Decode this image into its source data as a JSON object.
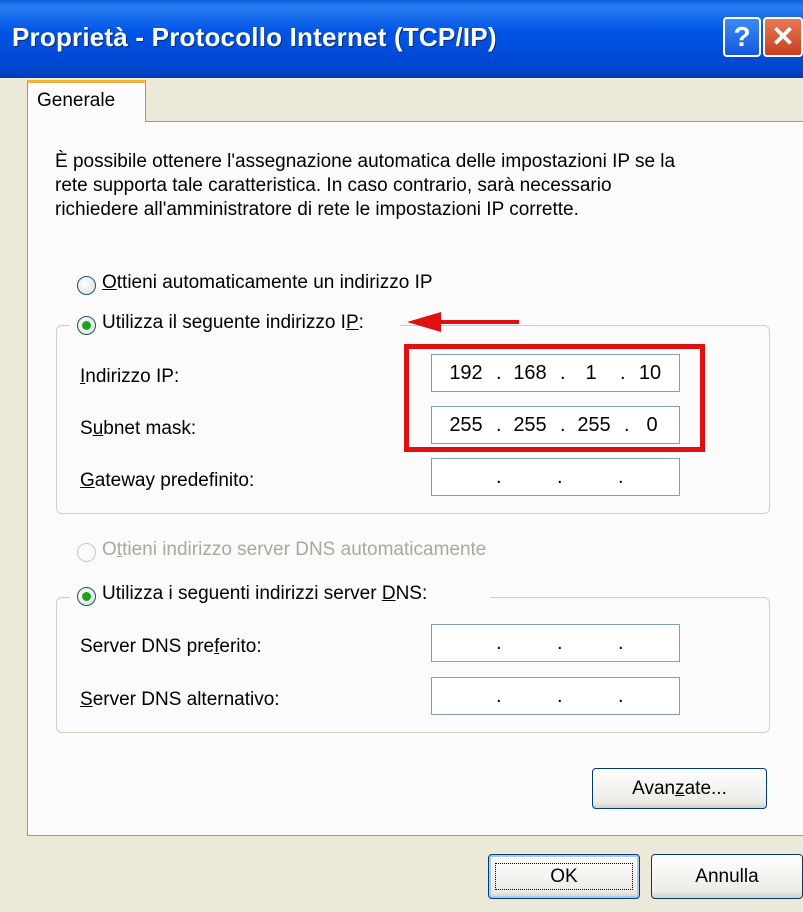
{
  "window": {
    "title": "Proprietà - Protocollo Internet (TCP/IP)",
    "help_glyph": "?",
    "close_glyph": "✕"
  },
  "tab": {
    "label": "Generale"
  },
  "intro": [
    "È possibile ottenere l'assegnazione automatica delle impostazioni IP se la",
    "rete supporta tale caratteristica. In caso contrario, sarà necessario",
    "richiedere all'amministratore di rete le impostazioni IP corrette."
  ],
  "ip": {
    "auto_radio": {
      "pre": "",
      "key": "O",
      "post": "ttieni automaticamente un indirizzo IP",
      "selected": false
    },
    "manual_radio": {
      "pre": "Utilizza il seguente indirizzo I",
      "key": "P",
      "post": ":",
      "selected": true
    },
    "address": {
      "pre": "",
      "key": "I",
      "post": "ndirizzo IP:",
      "octets": [
        "192",
        "168",
        "1",
        "10"
      ]
    },
    "subnet": {
      "pre": "S",
      "key": "u",
      "post": "bnet mask:",
      "octets": [
        "255",
        "255",
        "255",
        "0"
      ]
    },
    "gateway": {
      "pre": "",
      "key": "G",
      "post": "ateway predefinito:",
      "octets": [
        "",
        "",
        "",
        ""
      ]
    }
  },
  "dns": {
    "auto_radio": {
      "pre": "O",
      "key": "t",
      "post": "tieni indirizzo server DNS automaticamente",
      "selected": false,
      "enabled": false
    },
    "manual_radio": {
      "pre": "Utilizza i seguenti indirizzi server ",
      "key": "D",
      "post": "NS:",
      "selected": true
    },
    "preferred": {
      "pre": "Server DNS pre",
      "key": "f",
      "post": "erito:",
      "octets": [
        "",
        "",
        "",
        ""
      ]
    },
    "alternate": {
      "pre": "",
      "key": "S",
      "post": "erver DNS alternativo:",
      "octets": [
        "",
        "",
        "",
        ""
      ]
    }
  },
  "buttons": {
    "advanced": {
      "pre": "Avan",
      "key": "z",
      "post": "ate..."
    },
    "ok": "OK",
    "cancel": "Annulla"
  },
  "annotation": {
    "color": "#e01010"
  }
}
